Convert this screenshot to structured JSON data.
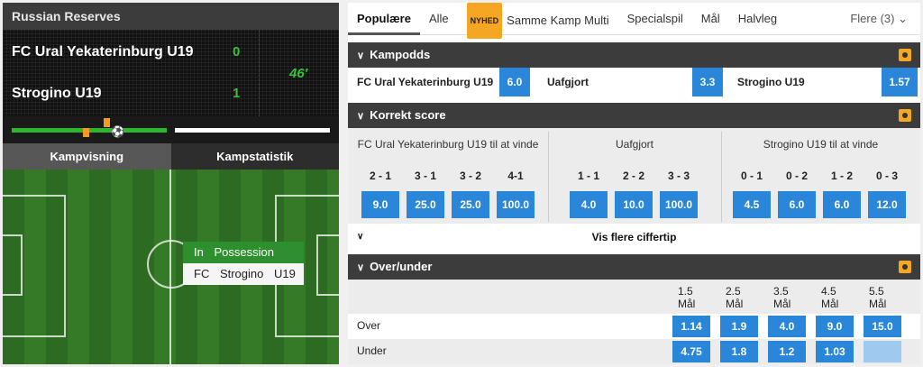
{
  "league": "Russian Reserves",
  "match": {
    "team1": "FC Ural Yekaterinburg U19",
    "team2": "Strogino U19",
    "score1": "0",
    "score2": "1",
    "minute": "46′"
  },
  "left_tabs": [
    "Kampvisning",
    "Kampstatistik"
  ],
  "possession": {
    "label": "In Possession",
    "team": "FC Strogino U19"
  },
  "main_tabs": {
    "t1": "Populære",
    "t2": "Alle",
    "new_badge": "NYHED",
    "t3": "Samme Kamp Multi",
    "t4": "Specialspil",
    "t5": "Mål",
    "t6": "Halvleg",
    "more": "Flere (3)"
  },
  "kampodds": {
    "title": "Kampodds",
    "home": {
      "label": "FC Ural Yekaterinburg U19",
      "odds": "6.0"
    },
    "draw": {
      "label": "Uafgjort",
      "odds": "3.3"
    },
    "away": {
      "label": "Strogino U19",
      "odds": "1.57"
    }
  },
  "correct_score": {
    "title": "Korrekt score",
    "col_home": "FC Ural Yekaterinburg U19 til at vinde",
    "col_draw": "Uafgjort",
    "col_away": "Strogino U19 til at vinde",
    "home": [
      {
        "s": "2 - 1",
        "o": "9.0"
      },
      {
        "s": "3 - 1",
        "o": "25.0"
      },
      {
        "s": "3 - 2",
        "o": "25.0"
      },
      {
        "s": "4-1",
        "o": "100.0"
      }
    ],
    "draw": [
      {
        "s": "1 - 1",
        "o": "4.0"
      },
      {
        "s": "2 - 2",
        "o": "10.0"
      },
      {
        "s": "3 - 3",
        "o": "100.0"
      }
    ],
    "away": [
      {
        "s": "0 - 1",
        "o": "4.5"
      },
      {
        "s": "0 - 2",
        "o": "6.0"
      },
      {
        "s": "1 - 2",
        "o": "6.0"
      },
      {
        "s": "0 - 3",
        "o": "12.0"
      }
    ],
    "more_link": "Vis flere ciffertip"
  },
  "over_under": {
    "title": "Over/under",
    "lines": [
      "1.5",
      "2.5",
      "3.5",
      "4.5",
      "5.5"
    ],
    "unit": "Mål",
    "over_label": "Over",
    "under_label": "Under",
    "over": [
      "1.14",
      "1.9",
      "4.0",
      "9.0",
      "15.0"
    ],
    "under": [
      "4.75",
      "1.8",
      "1.2",
      "1.03",
      ""
    ]
  },
  "colors": {
    "accent": "#2a86d8",
    "green": "#2fb52f",
    "badge": "#f5a623",
    "header": "#3c3c3c"
  }
}
